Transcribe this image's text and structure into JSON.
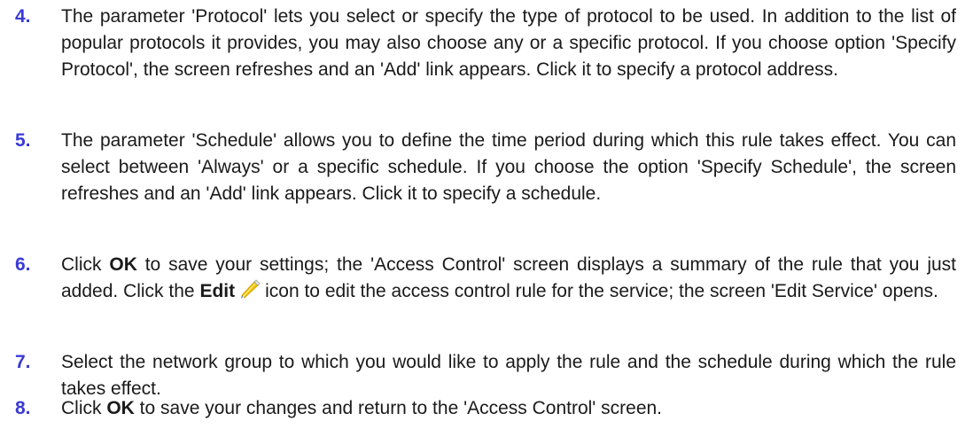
{
  "colors": {
    "step_number": "#3a3ad6",
    "text": "#1a1a1a",
    "pencil_body": "#f2c200",
    "pencil_tip": "#3b6fd6"
  },
  "steps": [
    {
      "number": "4.",
      "text": "The parameter 'Protocol' lets you select or specify the type of protocol to be used. In addition to the list of popular protocols it provides, you may also choose any or a specific protocol. If you choose option 'Specify Protocol', the screen refreshes and an 'Add' link appears. Click it to specify a protocol address."
    },
    {
      "number": "5.",
      "text": "The parameter 'Schedule' allows you to define the time period during which this rule takes effect. You can select between 'Always' or a specific schedule. If you choose the option 'Specify Schedule', the screen refreshes and an 'Add' link appears. Click it to specify a schedule."
    },
    {
      "number": "6.",
      "part1": "Click ",
      "bold1": "OK",
      "part2": " to save your settings; the 'Access Control' screen displays a summary of the rule that you just added. Click the ",
      "bold2": "Edit",
      "icon": "pencil-edit-icon",
      "part3": "icon to edit the access control rule for the service; the screen 'Edit Service' opens."
    },
    {
      "number": "7.",
      "text": "Select the network group to which you would like to apply the rule and the schedule during which the rule takes effect."
    },
    {
      "number": "8.",
      "part1": "Click ",
      "bold1": "OK",
      "part2": " to save your changes and return to the 'Access Control' screen."
    }
  ]
}
